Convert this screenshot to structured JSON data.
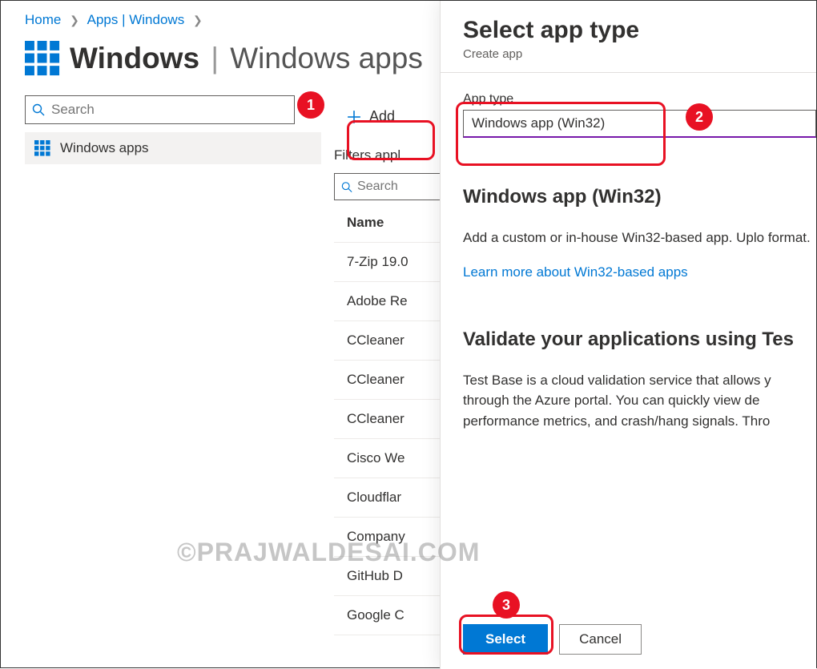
{
  "breadcrumb": {
    "home": "Home",
    "apps": "Apps | Windows"
  },
  "page": {
    "title_bold": "Windows",
    "title_light": "Windows apps"
  },
  "sidebar": {
    "search_placeholder": "Search",
    "items": [
      {
        "label": "Windows apps"
      }
    ]
  },
  "toolbar": {
    "add_label": "Add"
  },
  "filters": {
    "label": "Filters appl"
  },
  "main_search_placeholder": "Search",
  "table": {
    "header": "Name",
    "rows": [
      "7-Zip 19.0",
      "Adobe Re",
      "CCleaner",
      "CCleaner",
      "CCleaner",
      "Cisco We",
      "Cloudflar",
      "Company",
      "GitHub D",
      "Google C"
    ]
  },
  "panel": {
    "title": "Select app type",
    "subtitle": "Create app",
    "field_label": "App type",
    "dropdown_value": "Windows app (Win32)",
    "h2a": "Windows app (Win32)",
    "desc": "Add a custom or in-house Win32-based app. Uplo format.",
    "link": "Learn more about Win32-based apps",
    "h2b": "Validate your applications using Tes",
    "desc2": "Test Base is a cloud validation service that allows y through the Azure portal. You can quickly view de performance metrics, and crash/hang signals. Thro",
    "select_label": "Select",
    "cancel_label": "Cancel"
  },
  "watermark": "©PRAJWALDESAI.COM"
}
